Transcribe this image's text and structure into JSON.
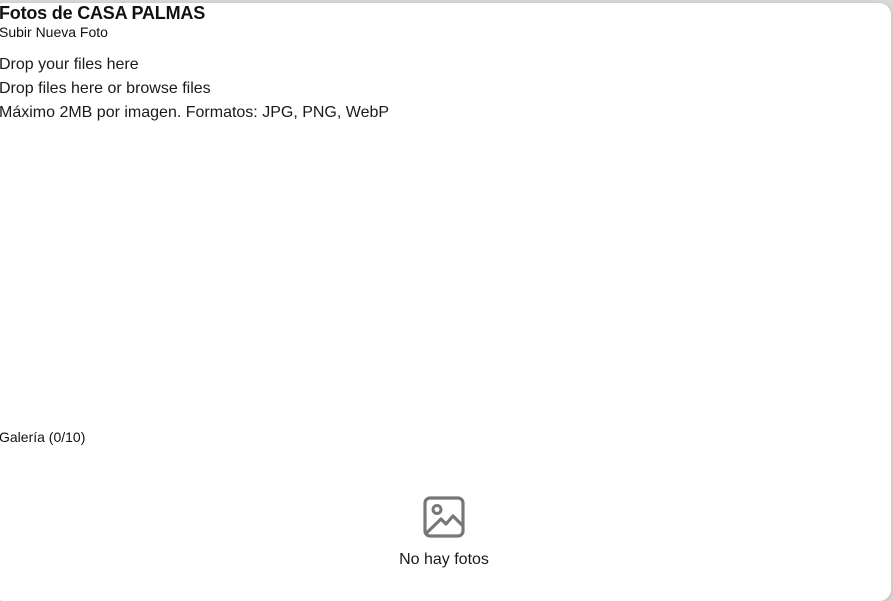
{
  "modal": {
    "title": "Fotos de CASA PALMAS"
  },
  "upload": {
    "section_title": "Subir Nueva Foto",
    "drop_label": "Drop your files here",
    "browse_label": "Drop files here or browse files",
    "hint": "Máximo 2MB por imagen. Formatos: JPG, PNG, WebP"
  },
  "gallery": {
    "title": "Galería (0/10)",
    "empty_icon": "image-icon",
    "empty_text": "No hay fotos"
  }
}
